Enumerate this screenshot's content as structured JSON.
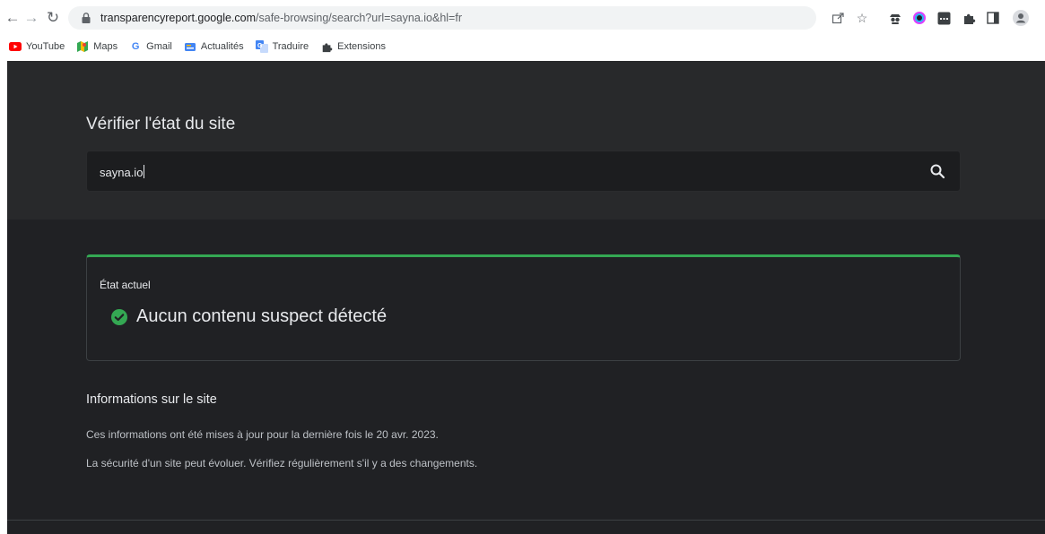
{
  "browser": {
    "url_host": "transparencyreport.google.com",
    "url_path": "/safe-browsing/search?url=sayna.io&hl=fr",
    "bookmarks": [
      {
        "label": "YouTube",
        "icon": "youtube-icon",
        "color": "#ff0000"
      },
      {
        "label": "Maps",
        "icon": "maps-icon",
        "color": "#34a853"
      },
      {
        "label": "Gmail",
        "icon": "google-icon",
        "color": "#4285f4"
      },
      {
        "label": "Actualités",
        "icon": "news-icon",
        "color": "#4285f4"
      },
      {
        "label": "Traduire",
        "icon": "translate-icon",
        "color": "#4285f4"
      },
      {
        "label": "Extensions",
        "icon": "puzzle-icon",
        "color": "#3c4043"
      }
    ]
  },
  "page": {
    "title": "Vérifier l'état du site",
    "search": {
      "value": "sayna.io"
    },
    "status": {
      "label": "État actuel",
      "text": "Aucun contenu suspect détecté",
      "color": "#34a853"
    },
    "info": {
      "title": "Informations sur le site",
      "line1": "Ces informations ont été mises à jour pour la dernière fois le 20 avr. 2023.",
      "line2": "La sécurité d'un site peut évoluer. Vérifiez régulièrement s'il y a des changements."
    }
  }
}
